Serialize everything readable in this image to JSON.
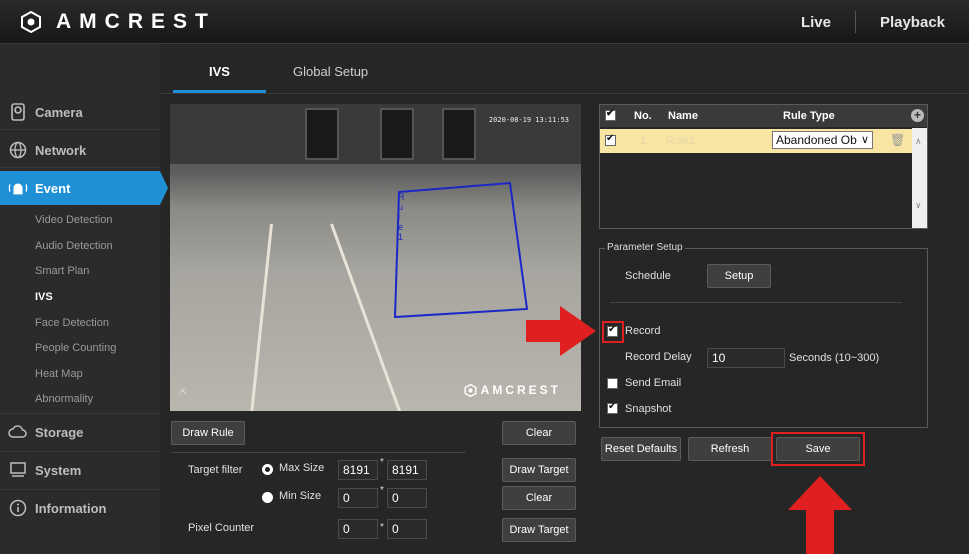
{
  "brand": {
    "name": "AMCREST"
  },
  "topnav": {
    "live": "Live",
    "playback": "Playback"
  },
  "sidebar": {
    "camera": "Camera",
    "network": "Network",
    "event": "Event",
    "subitems": [
      "Video Detection",
      "Audio Detection",
      "Smart Plan",
      "IVS",
      "Face Detection",
      "People Counting",
      "Heat Map",
      "Abnormality"
    ],
    "storage": "Storage",
    "system": "System",
    "information": "Information"
  },
  "tabs": {
    "ivs": "IVS",
    "global_setup": "Global Setup"
  },
  "video": {
    "timestamp": "2020-08-19 13:11:53",
    "rule_label": "Rule1",
    "watermark": "AMCREST"
  },
  "controls": {
    "draw_rule": "Draw Rule",
    "clear": "Clear",
    "target_filter": "Target filter",
    "max_size": "Max Size",
    "min_size": "Min Size",
    "max_w": "8191",
    "max_h": "8191",
    "min_w": "0",
    "min_h": "0",
    "draw_target": "Draw Target",
    "pixel_counter": "Pixel Counter",
    "pixel_w": "0",
    "pixel_h": "0",
    "star": "*"
  },
  "rule_table": {
    "headers": {
      "no": "No.",
      "name": "Name",
      "rule_type": "Rule Type"
    },
    "row": {
      "no": "1",
      "name": "Rule1",
      "rule_type": "Abandoned Ob"
    }
  },
  "param_setup": {
    "title": "Parameter Setup",
    "schedule": "Schedule",
    "setup": "Setup",
    "record": "Record",
    "record_delay": "Record Delay",
    "record_delay_value": "10",
    "seconds_range": "Seconds (10~300)",
    "send_email": "Send Email",
    "snapshot": "Snapshot",
    "record_checked": true,
    "send_email_checked": false,
    "snapshot_checked": true
  },
  "actions": {
    "reset_defaults": "Reset Defaults",
    "refresh": "Refresh",
    "save": "Save"
  },
  "colors": {
    "accent": "#1f8fd6",
    "highlight": "#e02020",
    "row_highlight": "#f8e5a4"
  }
}
